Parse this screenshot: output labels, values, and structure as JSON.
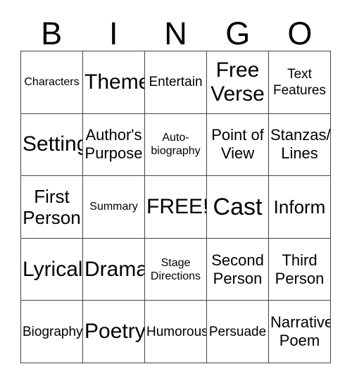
{
  "card": {
    "title": "BINGO",
    "header_letters": [
      "B",
      "I",
      "N",
      "G",
      "O"
    ],
    "columns": 5,
    "rows": 5,
    "colors": {
      "text": "#000000",
      "border": "#444444",
      "background": "#ffffff"
    },
    "free_space": {
      "label": "FREE!",
      "row": 3,
      "column": 3
    },
    "rows_data": [
      [
        {
          "label": "Characters",
          "size": "fs-s"
        },
        {
          "label": "Theme",
          "size": "fs-xxl"
        },
        {
          "label": "Entertain",
          "size": "fs-m"
        },
        {
          "label": "Free\nVerse",
          "size": "fs-xxl"
        },
        {
          "label": "Text\nFeatures",
          "size": "fs-m"
        }
      ],
      [
        {
          "label": "Setting",
          "size": "fs-xxl"
        },
        {
          "label": "Author's\nPurpose",
          "size": "fs-l"
        },
        {
          "label": "Auto-\nbiography",
          "size": "fs-s"
        },
        {
          "label": "Point of\nView",
          "size": "fs-l"
        },
        {
          "label": "Stanzas/\nLines",
          "size": "fs-l"
        }
      ],
      [
        {
          "label": "First\nPerson",
          "size": "fs-xl"
        },
        {
          "label": "Summary",
          "size": "fs-s"
        },
        {
          "label": "FREE!",
          "size": "fs-xxl"
        },
        {
          "label": "Cast",
          "size": "fs-huge"
        },
        {
          "label": "Inform",
          "size": "fs-xl"
        }
      ],
      [
        {
          "label": "Lyrical",
          "size": "fs-xxl"
        },
        {
          "label": "Drama",
          "size": "fs-xxl"
        },
        {
          "label": "Stage\nDirections",
          "size": "fs-s"
        },
        {
          "label": "Second\nPerson",
          "size": "fs-l"
        },
        {
          "label": "Third\nPerson",
          "size": "fs-l"
        }
      ],
      [
        {
          "label": "Biography",
          "size": "fs-m"
        },
        {
          "label": "Poetry",
          "size": "fs-xxl"
        },
        {
          "label": "Humorous",
          "size": "fs-m"
        },
        {
          "label": "Persuade",
          "size": "fs-m"
        },
        {
          "label": "Narrative\nPoem",
          "size": "fs-l"
        }
      ]
    ]
  }
}
